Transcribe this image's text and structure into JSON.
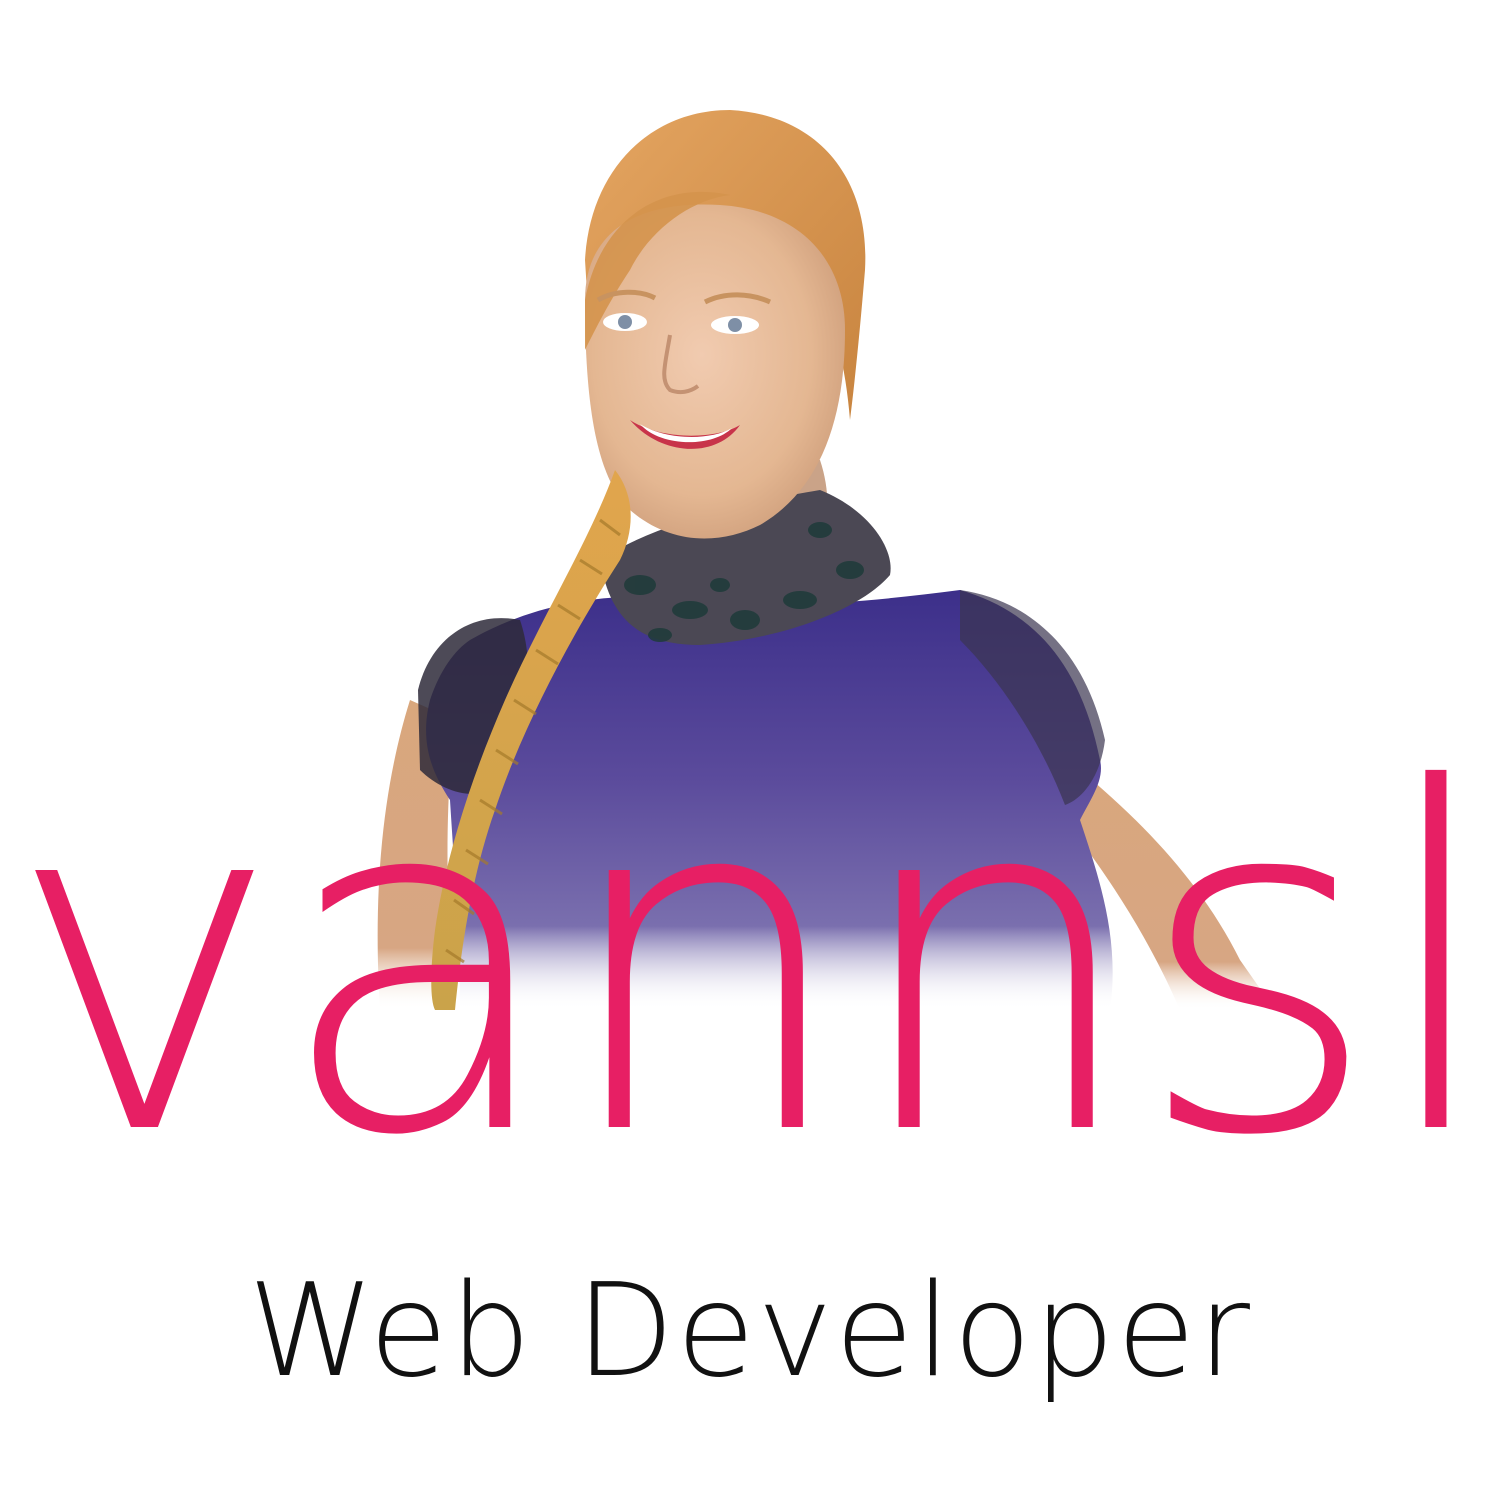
{
  "brand": {
    "name": "vannsl",
    "tagline": "Web Developer"
  },
  "colors": {
    "background": "#ffffff",
    "brand_pink": "#e71f64",
    "tagline_black": "#111111",
    "dress_purple": "#4a3f8f",
    "hair_ginger": "#d9964a",
    "skin": "#e8bc96"
  },
  "illustration": {
    "subject": "watercolor-portrait",
    "alt": "portrait"
  }
}
